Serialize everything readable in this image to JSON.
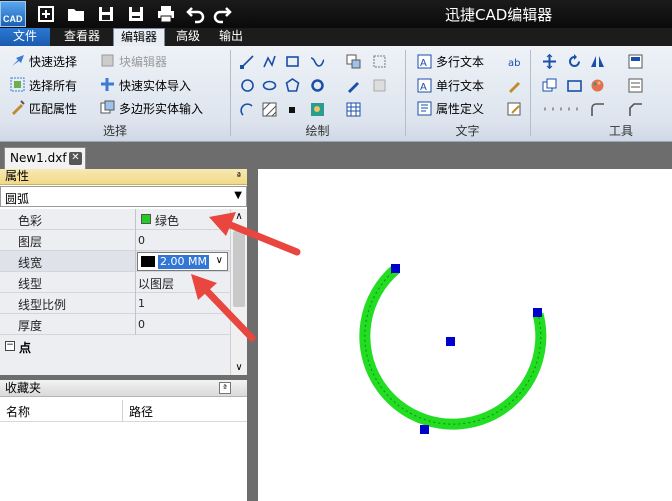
{
  "app": {
    "logo_text": "CAD",
    "title": "迅捷CAD编辑器"
  },
  "menu": {
    "tabs": [
      {
        "label": "文件"
      },
      {
        "label": "查看器"
      },
      {
        "label": "编辑器"
      },
      {
        "label": "高级"
      },
      {
        "label": "输出"
      }
    ],
    "active": "编辑器"
  },
  "ribbon": {
    "select_group": {
      "label": "选择",
      "quick_select": "快速选择",
      "select_all": "选择所有",
      "match_props": "匹配属性",
      "block_editor": "块编辑器",
      "quick_entity_import": "快速实体导入",
      "polygon_entity_input": "多边形实体输入"
    },
    "draw_group": {
      "label": "绘制"
    },
    "text_group": {
      "label": "文字",
      "mtext": "多行文本",
      "stext": "单行文本",
      "attdef": "属性定义"
    },
    "tools_group": {
      "label": "工具"
    }
  },
  "document": {
    "tab_label": "New1.dxf",
    "close_glyph": "✕"
  },
  "properties": {
    "header": "属性",
    "pin": "ª",
    "entity_type": "圆弧",
    "rows": [
      {
        "key": "色彩",
        "value": "绿色",
        "swatch": "#22cc22"
      },
      {
        "key": "图层",
        "value": "0"
      },
      {
        "key": "线宽",
        "value": "2.00 MM"
      },
      {
        "key": "线型",
        "value": "以图层"
      },
      {
        "key": "线型比例",
        "value": "1"
      },
      {
        "key": "厚度",
        "value": "0"
      }
    ],
    "category": {
      "expander": "−",
      "label": "点"
    }
  },
  "favorites": {
    "header": "收藏夹",
    "pin": "ª",
    "columns": [
      "名称",
      "路径"
    ]
  },
  "drawing": {
    "arc_color": "#22dd22",
    "grip_color": "#0000cc",
    "annotation_color": "#e8463f"
  }
}
